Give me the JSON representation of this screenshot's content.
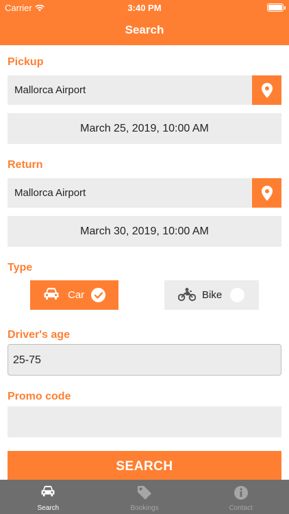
{
  "status_bar": {
    "carrier": "Carrier",
    "time": "3:40 PM"
  },
  "nav": {
    "title": "Search"
  },
  "pickup": {
    "label": "Pickup",
    "location": "Mallorca Airport",
    "datetime": "March 25, 2019, 10:00 AM"
  },
  "return": {
    "label": "Return",
    "location": "Mallorca Airport",
    "datetime": "March 30, 2019, 10:00 AM"
  },
  "type": {
    "label": "Type",
    "options": [
      {
        "label": "Car",
        "selected": true
      },
      {
        "label": "Bike",
        "selected": false
      }
    ]
  },
  "drivers_age": {
    "label": "Driver's age",
    "value": "25-75"
  },
  "promo_code": {
    "label": "Promo code",
    "value": ""
  },
  "search_button": {
    "label": "SEARCH"
  },
  "tabs": [
    {
      "label": "Search",
      "icon": "car-icon",
      "active": true
    },
    {
      "label": "Bookings",
      "icon": "tag-icon",
      "active": false
    },
    {
      "label": "Contact",
      "icon": "info-icon",
      "active": false
    }
  ],
  "colors": {
    "accent": "#ff7f32",
    "field": "#ececec",
    "tabbar": "#6e6e6e"
  }
}
